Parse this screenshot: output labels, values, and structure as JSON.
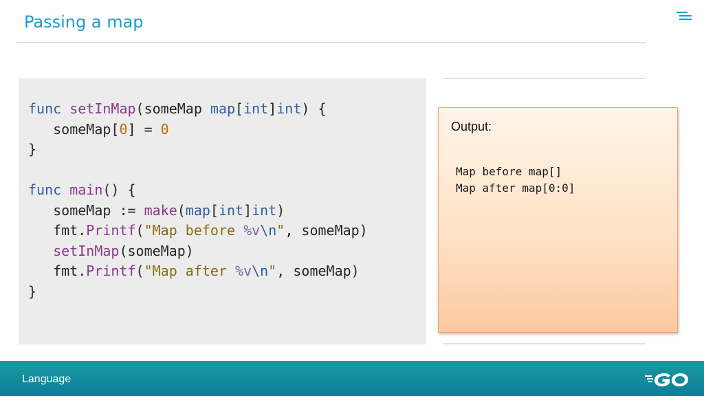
{
  "slide": {
    "title": "Passing a map"
  },
  "menu": {
    "icon": "menu-icon"
  },
  "code": {
    "lines": [
      "func setInMap(someMap map[int]int) {",
      "   someMap[0] = 0",
      "}",
      "",
      "func main() {",
      "   someMap := make(map[int]int)",
      "   fmt.Printf(\"Map before %v\\n\", someMap)",
      "   setInMap(someMap)",
      "   fmt.Printf(\"Map after %v\\n\", someMap)",
      "}"
    ]
  },
  "output": {
    "label": "Output:",
    "lines": [
      "Map before map[]",
      "Map after map[0:0]"
    ]
  },
  "footer": {
    "label": "Language",
    "logo": "go-logo-icon"
  },
  "colors": {
    "title": "#1a9bd1",
    "footer": "#0e8a9c",
    "output_bg": "#ffe3c8",
    "code_bg": "#ececec"
  }
}
